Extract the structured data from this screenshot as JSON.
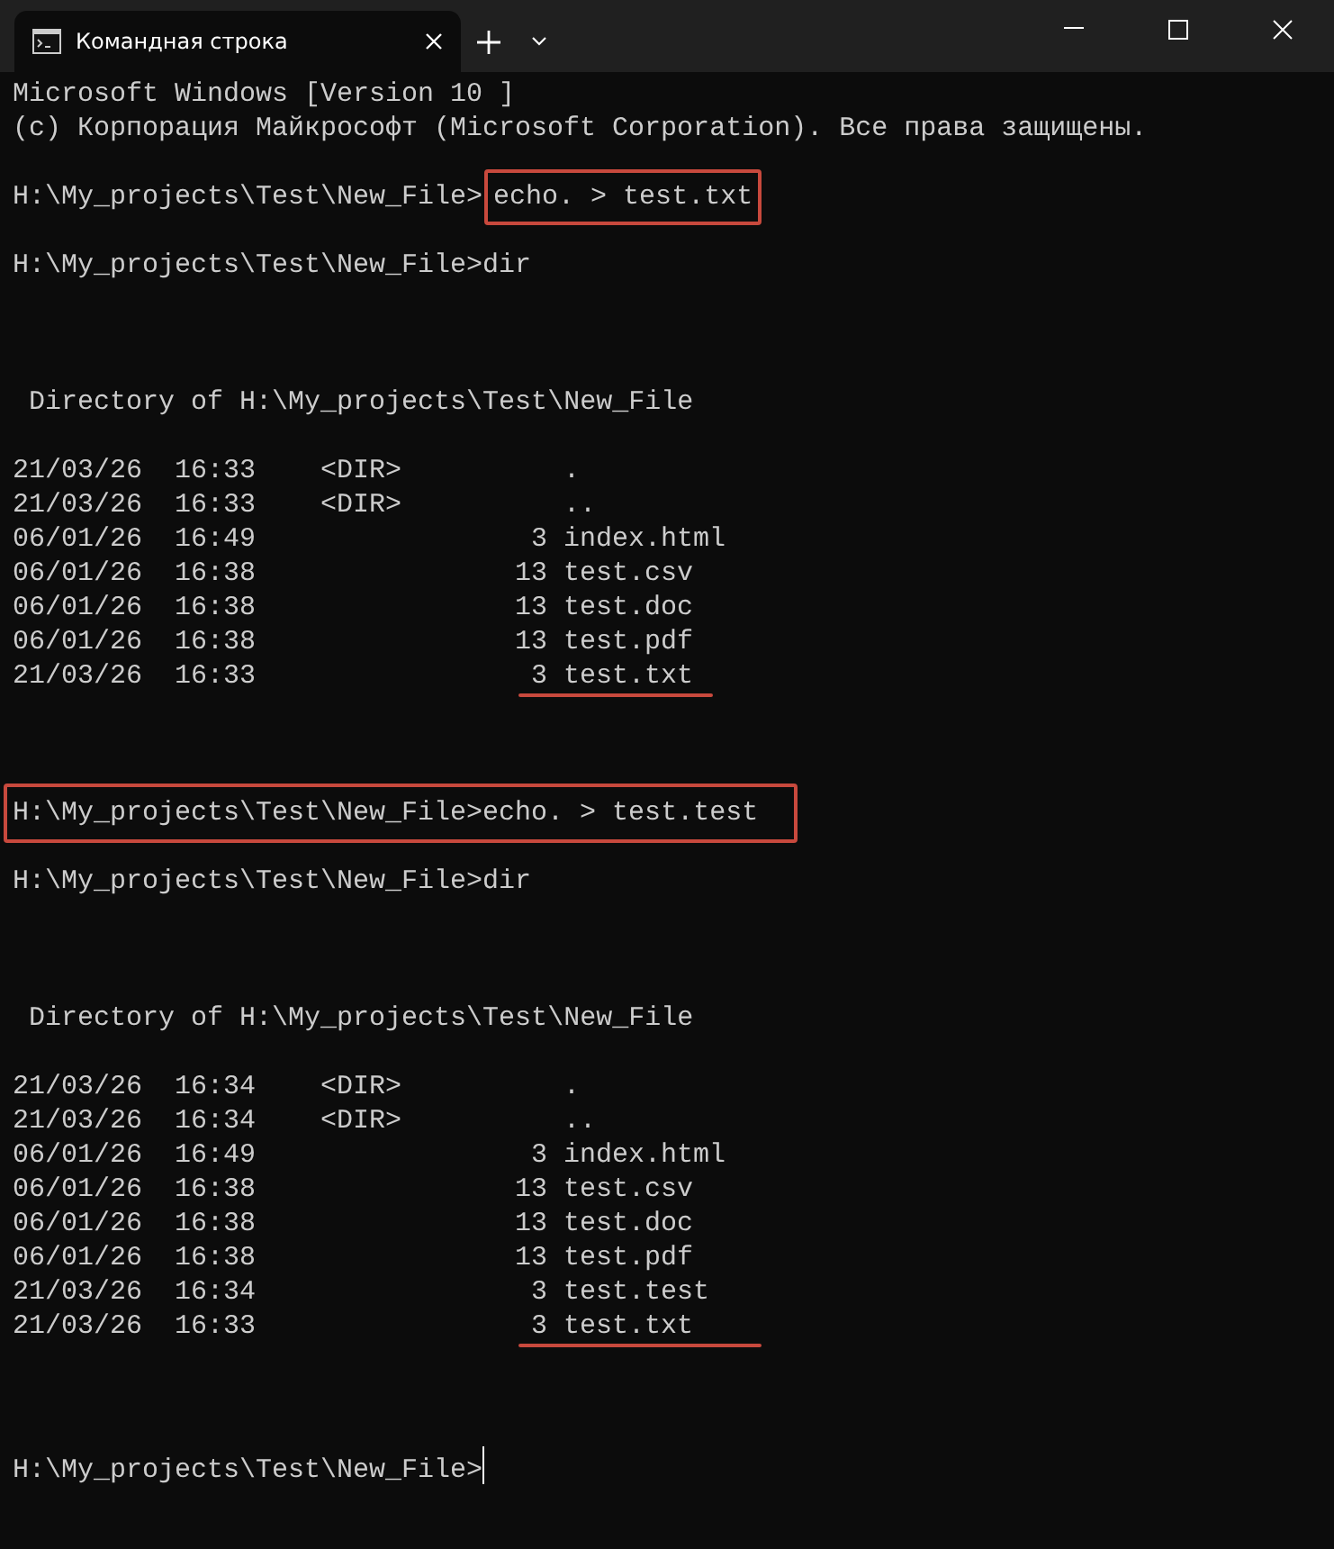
{
  "window": {
    "tab_title": "Командная строка"
  },
  "lines": [
    {
      "kind": "text",
      "text": "Microsoft Windows [Version 10 ]"
    },
    {
      "kind": "text",
      "text": "(c) Корпорация Майкрософт (Microsoft Corporation). Все права защищены."
    },
    {
      "kind": "blank"
    },
    {
      "kind": "prompt",
      "prompt": "H:\\My_projects\\Test\\New_File>",
      "command": "echo. > test.txt",
      "prompt_boxed": false,
      "command_boxed": true,
      "cursor": false
    },
    {
      "kind": "blank"
    },
    {
      "kind": "prompt",
      "prompt": "H:\\My_projects\\Test\\New_File>",
      "command": "dir",
      "prompt_boxed": false,
      "command_boxed": false,
      "cursor": false
    },
    {
      "kind": "blank"
    },
    {
      "kind": "blank"
    },
    {
      "kind": "blank"
    },
    {
      "kind": "heading",
      "text": "Directory of H:\\My_projects\\Test\\New_File"
    },
    {
      "kind": "blank"
    },
    {
      "kind": "entry",
      "date": "21/03/26",
      "time": "16:33",
      "dir": "<DIR>",
      "name": ".",
      "underlined": false
    },
    {
      "kind": "entry",
      "date": "21/03/26",
      "time": "16:33",
      "dir": "<DIR>",
      "name": "..",
      "underlined": false
    },
    {
      "kind": "entry",
      "date": "06/01/26",
      "time": "16:49",
      "size": "3",
      "name": "index.html",
      "underlined": false
    },
    {
      "kind": "entry",
      "date": "06/01/26",
      "time": "16:38",
      "size": "13",
      "name": "test.csv",
      "underlined": false
    },
    {
      "kind": "entry",
      "date": "06/01/26",
      "time": "16:38",
      "size": "13",
      "name": "test.doc",
      "underlined": false
    },
    {
      "kind": "entry",
      "date": "06/01/26",
      "time": "16:38",
      "size": "13",
      "name": "test.pdf",
      "underlined": false
    },
    {
      "kind": "entry",
      "date": "21/03/26",
      "time": "16:33",
      "size": "3",
      "name": "test.txt",
      "underlined": true
    },
    {
      "kind": "blank"
    },
    {
      "kind": "blank"
    },
    {
      "kind": "blank"
    },
    {
      "kind": "prompt",
      "prompt": "H:\\My_projects\\Test\\New_File>",
      "command": "echo. > test.test",
      "prompt_boxed": true,
      "command_boxed": true,
      "cursor": false
    },
    {
      "kind": "blank"
    },
    {
      "kind": "prompt",
      "prompt": "H:\\My_projects\\Test\\New_File>",
      "command": "dir",
      "prompt_boxed": false,
      "command_boxed": false,
      "cursor": false
    },
    {
      "kind": "blank"
    },
    {
      "kind": "blank"
    },
    {
      "kind": "blank"
    },
    {
      "kind": "heading",
      "text": "Directory of H:\\My_projects\\Test\\New_File"
    },
    {
      "kind": "blank"
    },
    {
      "kind": "entry",
      "date": "21/03/26",
      "time": "16:34",
      "dir": "<DIR>",
      "name": ".",
      "underlined": false
    },
    {
      "kind": "entry",
      "date": "21/03/26",
      "time": "16:34",
      "dir": "<DIR>",
      "name": "..",
      "underlined": false
    },
    {
      "kind": "entry",
      "date": "06/01/26",
      "time": "16:49",
      "size": "3",
      "name": "index.html",
      "underlined": false
    },
    {
      "kind": "entry",
      "date": "06/01/26",
      "time": "16:38",
      "size": "13",
      "name": "test.csv",
      "underlined": false
    },
    {
      "kind": "entry",
      "date": "06/01/26",
      "time": "16:38",
      "size": "13",
      "name": "test.doc",
      "underlined": false
    },
    {
      "kind": "entry",
      "date": "06/01/26",
      "time": "16:38",
      "size": "13",
      "name": "test.pdf",
      "underlined": false
    },
    {
      "kind": "entry",
      "date": "21/03/26",
      "time": "16:34",
      "size": "3",
      "name": "test.test",
      "underlined": false
    },
    {
      "kind": "entry",
      "date": "21/03/26",
      "time": "16:33",
      "size": "3",
      "name": "test.txt",
      "underlined": true
    },
    {
      "kind": "blank"
    },
    {
      "kind": "blank"
    },
    {
      "kind": "blank"
    },
    {
      "kind": "prompt",
      "prompt": "H:\\My_projects\\Test\\New_File>",
      "prompt_boxed": false,
      "command_boxed": false,
      "cursor": true
    }
  ]
}
